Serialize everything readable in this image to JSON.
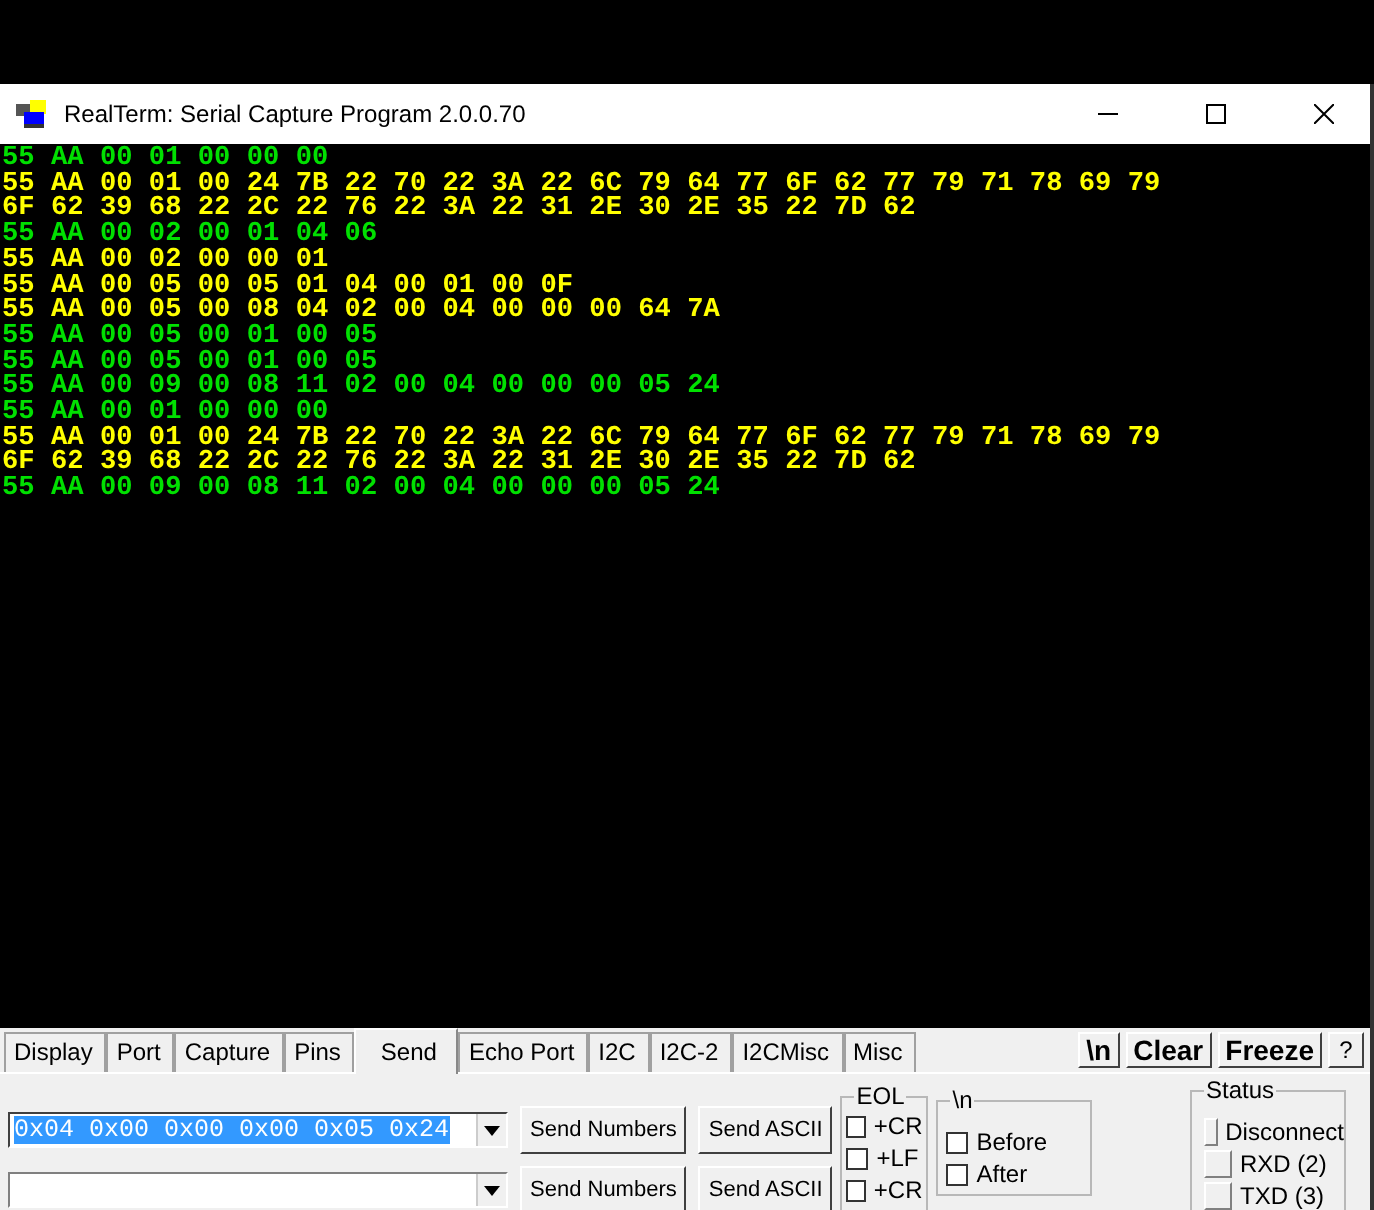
{
  "window": {
    "title": "RealTerm: Serial Capture Program 2.0.0.70"
  },
  "terminal": {
    "lines": [
      {
        "text": "55 AA 00 01 00 00 00",
        "kind": "rx"
      },
      {
        "text": "55 AA 00 01 00 24 7B 22 70 22 3A 22 6C 79 64 77 6F 62 77 79 71 78 69 79",
        "kind": "tx"
      },
      {
        "text": "6F 62 39 68 22 2C 22 76 22 3A 22 31 2E 30 2E 35 22 7D 62",
        "kind": "tx"
      },
      {
        "text": "55 AA 00 02 00 01 04 06",
        "kind": "rx"
      },
      {
        "text": "55 AA 00 02 00 00 01",
        "kind": "tx"
      },
      {
        "text": "55 AA 00 05 00 05 01 04 00 01 00 0F",
        "kind": "tx"
      },
      {
        "text": "55 AA 00 05 00 08 04 02 00 04 00 00 00 64 7A",
        "kind": "tx"
      },
      {
        "text": "55 AA 00 05 00 01 00 05",
        "kind": "rx"
      },
      {
        "text": "55 AA 00 05 00 01 00 05",
        "kind": "rx"
      },
      {
        "text": "55 AA 00 09 00 08 11 02 00 04 00 00 00 05 24",
        "kind": "rx"
      },
      {
        "text": "55 AA 00 01 00 00 00",
        "kind": "rx"
      },
      {
        "text": "55 AA 00 01 00 24 7B 22 70 22 3A 22 6C 79 64 77 6F 62 77 79 71 78 69 79",
        "kind": "tx"
      },
      {
        "text": "6F 62 39 68 22 2C 22 76 22 3A 22 31 2E 30 2E 35 22 7D 62",
        "kind": "tx"
      },
      {
        "text": "55 AA 00 09 00 08 11 02 00 04 00 00 00 05 24",
        "kind": "rx"
      }
    ]
  },
  "tabs": [
    {
      "label": "Display",
      "selected": false
    },
    {
      "label": "Port",
      "selected": false
    },
    {
      "label": "Capture",
      "selected": false
    },
    {
      "label": "Pins",
      "selected": false
    },
    {
      "label": "Send",
      "selected": true
    },
    {
      "label": "Echo Port",
      "selected": false
    },
    {
      "label": "I2C",
      "selected": false
    },
    {
      "label": "I2C-2",
      "selected": false
    },
    {
      "label": "I2CMisc",
      "selected": false
    },
    {
      "label": "Misc",
      "selected": false
    }
  ],
  "toolbar_buttons": [
    "\\n",
    "Clear",
    "Freeze",
    "?"
  ],
  "send_rows": [
    {
      "value": "0x04 0x00 0x00 0x00 0x05 0x24",
      "selected": true,
      "send_numbers": "Send Numbers",
      "send_ascii": "Send ASCII"
    },
    {
      "value": "",
      "selected": false,
      "send_numbers": "Send Numbers",
      "send_ascii": "Send ASCII"
    }
  ],
  "eol": {
    "title": "EOL",
    "options": [
      {
        "label": "+CR",
        "checked": false
      },
      {
        "label": "+LF",
        "checked": false
      },
      {
        "label": "+CR",
        "checked": false
      }
    ]
  },
  "newline": {
    "title": "\\n",
    "options": [
      {
        "label": "Before",
        "checked": false
      },
      {
        "label": "After",
        "checked": false
      }
    ]
  },
  "status": {
    "title": "Status",
    "items": [
      {
        "label": "Disconnect",
        "on": false
      },
      {
        "label": "RXD (2)",
        "on": false
      },
      {
        "label": "TXD (3)",
        "on": false
      }
    ]
  }
}
